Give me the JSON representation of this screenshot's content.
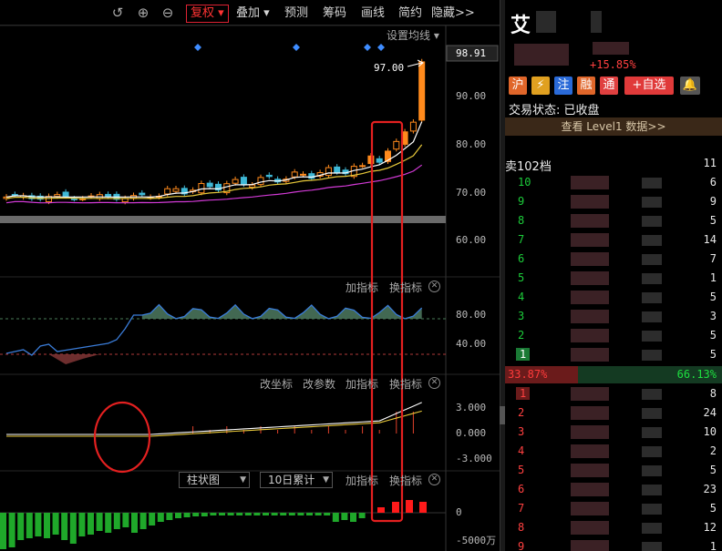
{
  "toolbar": {
    "buttons": [
      "复权",
      "叠加",
      "预测",
      "筹码",
      "画线",
      "简约",
      "隐藏>>"
    ],
    "icons": [
      "undo-icon",
      "zoom-in-icon",
      "zoom-out-icon"
    ]
  },
  "price_pane": {
    "settings_label": "设置均线",
    "current_price": "98.91",
    "high_annotation": "97.00",
    "axis": [
      "90.00",
      "80.00",
      "70.00",
      "60.00"
    ],
    "colors": {
      "up": "#ff8a1c",
      "down": "#3fb8d6",
      "ma_white": "#ffffff",
      "ma_yellow": "#e8c93a",
      "ma_magenta": "#d23ad6"
    }
  },
  "indicator1": {
    "links": [
      "加指标",
      "换指标"
    ],
    "axis": [
      "80.00",
      "40.00"
    ]
  },
  "indicator2": {
    "links": [
      "改坐标",
      "改参数",
      "加指标",
      "换指标"
    ],
    "axis": [
      "3.000",
      "0.000",
      "-3.000"
    ]
  },
  "indicator3": {
    "dropdown1": "柱状图",
    "dropdown2": "10日累计",
    "links": [
      "加指标",
      "换指标"
    ],
    "axis": [
      "0",
      "-5000万"
    ]
  },
  "stock": {
    "name_char": "艾",
    "change_pct": "+15.85%",
    "tags": [
      "沪",
      "⚡",
      "注",
      "融",
      "通",
      "+自选"
    ],
    "status_label": "交易状态: 已收盘",
    "level1_link": "查看 Level1 数据>>"
  },
  "order_book": {
    "header": "卖102档",
    "header_vol": "11",
    "asks": [
      {
        "level": "10",
        "vol": "6"
      },
      {
        "level": "9",
        "vol": "9"
      },
      {
        "level": "8",
        "vol": "5"
      },
      {
        "level": "7",
        "vol": "14"
      },
      {
        "level": "6",
        "vol": "7"
      },
      {
        "level": "5",
        "vol": "1"
      },
      {
        "level": "4",
        "vol": "5"
      },
      {
        "level": "3",
        "vol": "3"
      },
      {
        "level": "2",
        "vol": "5"
      },
      {
        "level": "1",
        "vol": "5"
      }
    ],
    "sell_ratio": "33.87%",
    "buy_ratio": "66.13%",
    "bids": [
      {
        "level": "1",
        "vol": "8"
      },
      {
        "level": "2",
        "vol": "24"
      },
      {
        "level": "3",
        "vol": "10"
      },
      {
        "level": "4",
        "vol": "2"
      },
      {
        "level": "5",
        "vol": "5"
      },
      {
        "level": "6",
        "vol": "23"
      },
      {
        "level": "7",
        "vol": "5"
      },
      {
        "level": "8",
        "vol": "12"
      },
      {
        "level": "9",
        "vol": "1"
      }
    ]
  }
}
